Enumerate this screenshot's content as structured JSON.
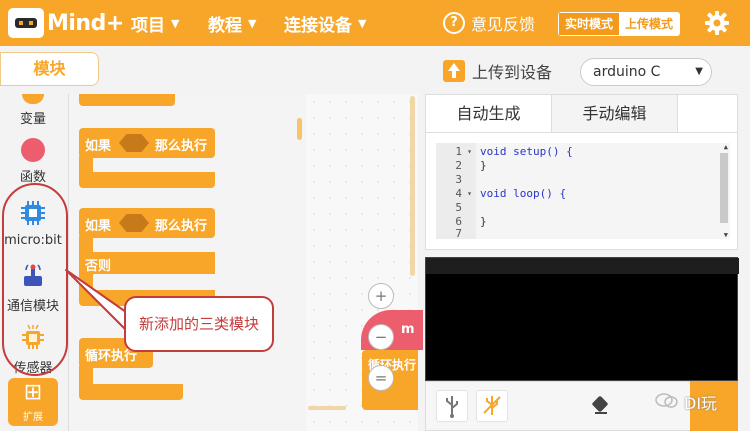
{
  "topbar": {
    "brand": "Mind+",
    "menu": [
      "项目",
      "教程",
      "连接设备"
    ],
    "feedback_label": "意见反馈",
    "mode_realtime": "实时模式",
    "mode_upload": "上传模式",
    "caret": "▼",
    "accent_color": "#f7a62a"
  },
  "subbar": {
    "blocks_label": "模块",
    "upload_label": "上传到设备",
    "board": "arduino C"
  },
  "categories": [
    {
      "label": "变量",
      "icon": "variable-dot-icon"
    },
    {
      "label": "函数",
      "icon": "function-dot-icon"
    },
    {
      "label": "micro:bit",
      "icon": "microbit-chip-icon"
    },
    {
      "label": "通信模块",
      "icon": "communication-antenna-icon"
    },
    {
      "label": "传感器",
      "icon": "sensor-chip-icon"
    }
  ],
  "extend_label": "扩展",
  "palette": {
    "if_label": "如果",
    "then_label": "那么执行",
    "else_label": "否则",
    "loop_label": "循环执行"
  },
  "workspace": {
    "zoom_in": "+",
    "zoom_out": "−",
    "zoom_reset": "=",
    "edge_letter": "m",
    "edge_block": "循环执行"
  },
  "code": {
    "tab_auto": "自动生成",
    "tab_manual": "手动编辑",
    "lines": [
      {
        "n": "1",
        "fold": "▾",
        "text": "void setup() {"
      },
      {
        "n": "2",
        "fold": "",
        "text": "}"
      },
      {
        "n": "3",
        "fold": "",
        "text": ""
      },
      {
        "n": "4",
        "fold": "▾",
        "text": "void loop() {"
      },
      {
        "n": "5",
        "fold": "",
        "text": ""
      },
      {
        "n": "6",
        "fold": "",
        "text": "}"
      },
      {
        "n": "7",
        "fold": "",
        "text": ""
      }
    ]
  },
  "annotation": {
    "text": "新添加的三类模块",
    "color": "#c43c3c"
  },
  "watermark": "DI玩"
}
